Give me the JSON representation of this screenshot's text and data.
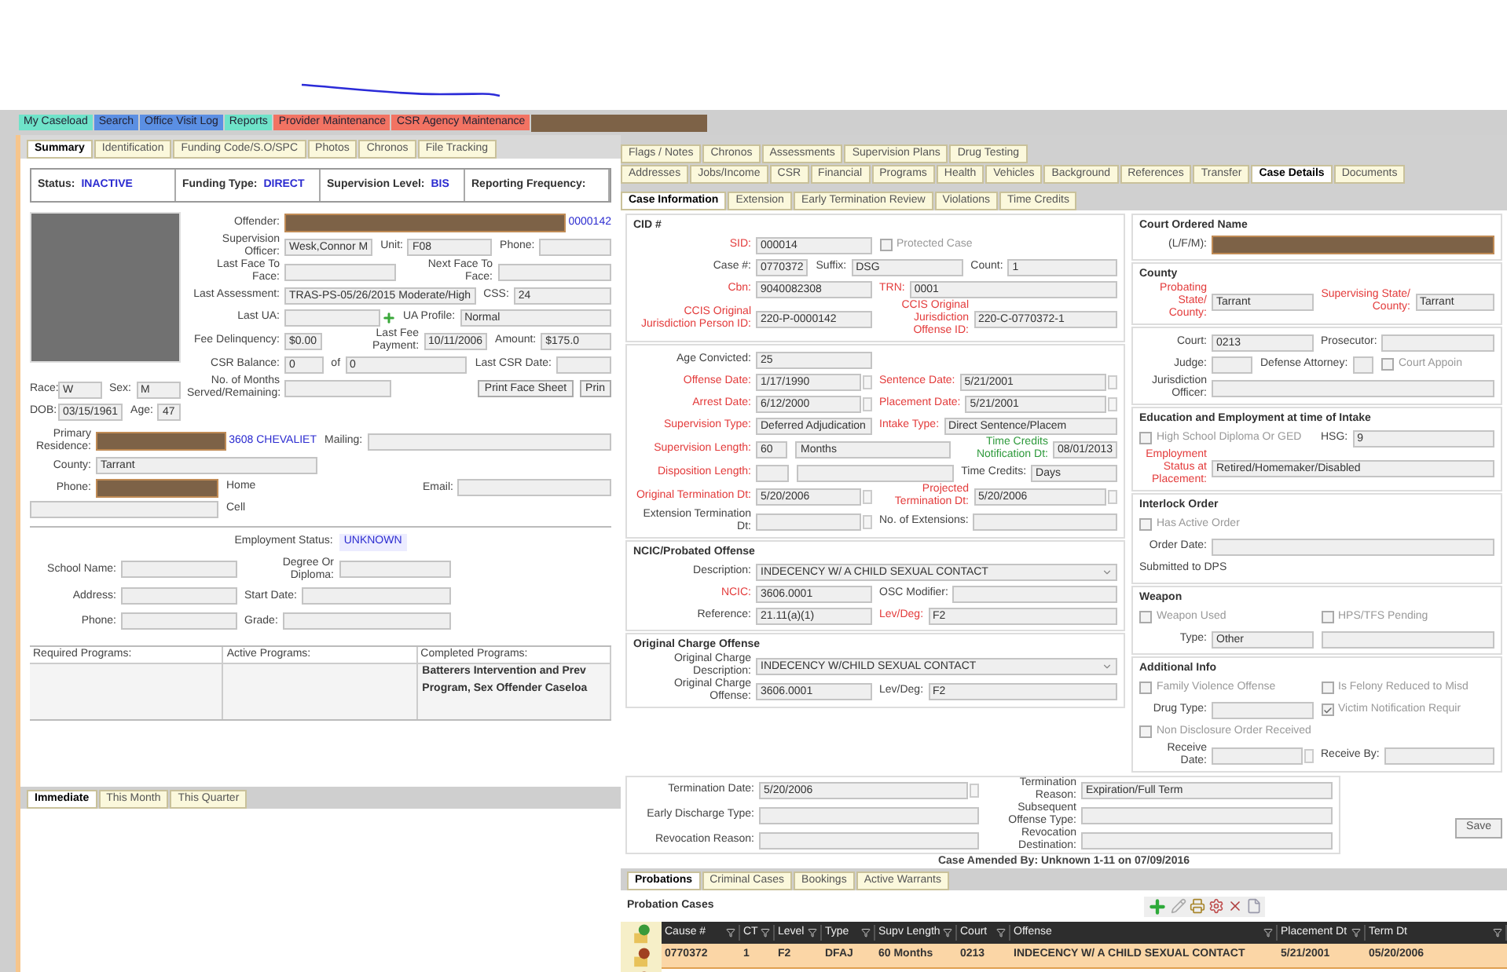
{
  "menu": [
    {
      "label": "My Caseload",
      "color": "#6fe3c9"
    },
    {
      "label": "Search",
      "color": "#5b8fe3"
    },
    {
      "label": "Office Visit Log",
      "color": "#5b8fe3"
    },
    {
      "label": "Reports",
      "color": "#6fe3c9"
    },
    {
      "label": "Provider Maintenance",
      "color": "#f27363"
    },
    {
      "label": "CSR Agency Maintenance",
      "color": "#f27363"
    }
  ],
  "menu_redacted": true,
  "left": {
    "tabs": [
      {
        "label": "Summary",
        "selected": true
      },
      {
        "label": "Identification",
        "selected": false
      },
      {
        "label": "Funding Code/S.O/SPC",
        "selected": false
      },
      {
        "label": "Photos",
        "selected": false
      },
      {
        "label": "Chronos",
        "selected": false
      },
      {
        "label": "File Tracking",
        "selected": false
      }
    ],
    "status": [
      {
        "label": "Status:",
        "value": "INACTIVE"
      },
      {
        "label": "Funding Type:",
        "value": "DIRECT"
      },
      {
        "label": "Supervision Level:",
        "value": "BIS"
      },
      {
        "label": "Reporting Frequency:"
      }
    ],
    "offender_rows": [
      [
        {
          "label": "Offender:",
          "value": "0000142",
          "redacted": true
        }
      ],
      [
        {
          "label": "Supervision Officer:",
          "value": "Wesk,Connor M"
        },
        {
          "label": "Unit:",
          "value": "F08"
        },
        {
          "label": "Phone:"
        }
      ],
      [
        {
          "label": "Last Face To Face:"
        },
        {
          "label": "Next Face To Face:"
        }
      ],
      [
        {
          "label": "Last Assessment:",
          "value": "TRAS-PS-05/26/2015 Moderate/High"
        },
        {
          "label": "CSS:",
          "value": "24"
        }
      ],
      [
        {
          "label": "Last UA:",
          "kind": "add"
        },
        {
          "label": "UA Profile:",
          "value": "Normal"
        }
      ],
      [
        {
          "label": "Fee Delinquency:",
          "value": "$0.00"
        },
        {
          "label": "Last Fee Payment:",
          "value": "10/11/2006"
        },
        {
          "label": "Amount:",
          "value": "$175.0"
        }
      ],
      [
        {
          "label": "CSR Balance:",
          "value": "0"
        },
        {
          "label": "of",
          "value": "0"
        },
        {
          "label": "Last CSR Date:"
        }
      ]
    ],
    "months_field": {
      "label": "No. of Months Served/Remaining:"
    },
    "face_sheet_buttons": [
      "Print Face Sheet",
      "Prin"
    ],
    "demographics": [
      [
        {
          "label": "Race:",
          "value": "W"
        },
        {
          "label": "Sex:",
          "value": "M"
        }
      ],
      [
        {
          "label": "DOB:",
          "value": "03/15/1961"
        },
        {
          "label": "Age:",
          "value": "47"
        }
      ]
    ],
    "contact_rows": [
      [
        {
          "label": "Primary Residence:",
          "value": "3608 CHEVALIET",
          "redacted": true
        },
        {
          "label": "Mailing:"
        }
      ],
      [
        {
          "label": "County:",
          "value": "Tarrant"
        },
        {
          "kind": "blank"
        }
      ],
      [
        {
          "label": "Phone:",
          "redacted": true
        },
        {
          "label": "Home",
          "kind": "note"
        },
        {
          "label": "Email:"
        }
      ],
      [
        {
          "kind": "box"
        },
        {
          "label": "Cell",
          "kind": "note"
        },
        {
          "kind": "blank"
        }
      ]
    ],
    "employment": {
      "label": "Employment Status:",
      "value": "UNKNOWN"
    },
    "school_rows": [
      [
        {
          "label": "School Name:"
        },
        {
          "label": "Degree Or Diploma:"
        }
      ],
      [
        {
          "label": "Address:"
        },
        {
          "label": "Start Date:"
        }
      ],
      [
        {
          "label": "Phone:"
        },
        {
          "label": "Grade:"
        }
      ]
    ],
    "programs": {
      "columns": [
        "Required Programs:",
        "Active Programs:",
        "Completed Programs:"
      ],
      "completed": [
        "Batterers Intervention and Prev",
        "Program, Sex Offender Caseloa"
      ]
    },
    "bottom_tabs": [
      {
        "label": "Immediate",
        "selected": true
      },
      {
        "label": "This Month",
        "selected": false
      },
      {
        "label": "This Quarter",
        "selected": false
      }
    ]
  },
  "right": {
    "tab_rows": [
      [
        {
          "label": "Flags / Notes",
          "selected": false
        },
        {
          "label": "Chronos",
          "selected": false
        },
        {
          "label": "Assessments",
          "selected": false
        },
        {
          "label": "Supervision Plans",
          "selected": false
        },
        {
          "label": "Drug Testing",
          "selected": false
        }
      ],
      [
        {
          "label": "Addresses",
          "selected": false
        },
        {
          "label": "Jobs/Income",
          "selected": false
        },
        {
          "label": "CSR",
          "selected": false
        },
        {
          "label": "Financial",
          "selected": false
        },
        {
          "label": "Programs",
          "selected": false
        },
        {
          "label": "Health",
          "selected": false
        },
        {
          "label": "Vehicles",
          "selected": false
        },
        {
          "label": "Background",
          "selected": false
        },
        {
          "label": "References",
          "selected": false
        },
        {
          "label": "Transfer",
          "selected": false
        },
        {
          "label": "Case Details",
          "selected": true
        },
        {
          "label": "Documents",
          "selected": false
        }
      ],
      [
        {
          "label": "Case Information",
          "selected": true
        },
        {
          "label": "Extension",
          "selected": false
        },
        {
          "label": "Early Termination Review",
          "selected": false
        },
        {
          "label": "Violations",
          "selected": false
        },
        {
          "label": "Time Credits",
          "selected": false
        }
      ]
    ],
    "case_sections": [
      {
        "title": "CID #",
        "rows": [
          [
            {
              "label": "SID:",
              "value": "000014",
              "color": "#e33b3b"
            },
            {
              "label": "Protected Case",
              "kind": "check",
              "checked": false
            }
          ],
          [
            {
              "label": "Case #:",
              "value": "0770372"
            },
            {
              "label": "Suffix:",
              "value": "DSG"
            },
            {
              "label": "Count:",
              "value": "1"
            }
          ],
          [
            {
              "label": "Cbn:",
              "value": "9040082308",
              "color": "#e33b3b"
            },
            {
              "label": "TRN:",
              "value": "0001",
              "color": "#e33b3b"
            }
          ],
          [
            {
              "label": "CCIS Original Jurisdiction Person ID:",
              "value": "220-P-0000142",
              "color": "#e33b3b"
            },
            {
              "label": "CCIS Original Jurisdiction Offense ID:",
              "value": "220-C-0770372-1",
              "color": "#e33b3b"
            }
          ]
        ]
      },
      {
        "rows": [
          [
            {
              "label": "Age Convicted:",
              "value": "25"
            },
            {
              "kind": "blank"
            }
          ],
          [
            {
              "label": "Offense Date:",
              "value": "1/17/1990",
              "color": "#e33b3b",
              "kind": "date"
            },
            {
              "label": "Sentence Date:",
              "value": "5/21/2001",
              "color": "#e33b3b",
              "kind": "date"
            }
          ],
          [
            {
              "label": "Arrest Date:",
              "value": "6/12/2000",
              "color": "#e33b3b",
              "kind": "date"
            },
            {
              "label": "Placement Date:",
              "value": "5/21/2001",
              "color": "#e33b3b",
              "kind": "date"
            }
          ],
          [
            {
              "label": "Supervision Type:",
              "value": "Deferred Adjudication",
              "color": "#e33b3b"
            },
            {
              "label": "Intake Type:",
              "value": "Direct Sentence/Placem",
              "color": "#e33b3b"
            }
          ],
          [
            {
              "label": "Supervision Length:",
              "value": "60",
              "color": "#e33b3b"
            },
            {
              "value": "Months",
              "kind": "bare"
            },
            {
              "label": "Time Credits Notification Dt:",
              "value": "08/01/2013",
              "color": "#2e9a3c"
            }
          ],
          [
            {
              "label": "Disposition Length:",
              "color": "#e33b3b"
            },
            {
              "kind": "bare"
            },
            {
              "label": "Time Credits:",
              "value": "Days"
            }
          ],
          [
            {
              "label": "Original Termination Dt:",
              "value": "5/20/2006",
              "color": "#e33b3b",
              "kind": "date"
            },
            {
              "label": "Projected Termination Dt:",
              "value": "5/20/2006",
              "color": "#e33b3b",
              "kind": "date"
            }
          ],
          [
            {
              "label": "Extension Termination Dt:",
              "kind": "date"
            },
            {
              "label": "No. of Extensions:"
            }
          ]
        ]
      },
      {
        "title": "NCIC/Probated Offense",
        "rows": [
          [
            {
              "label": "Description:",
              "value": "INDECENCY W/ A CHILD SEXUAL CONTACT",
              "kind": "select"
            }
          ],
          [
            {
              "label": "NCIC:",
              "value": "3606.0001",
              "color": "#e33b3b"
            },
            {
              "label": "OSC Modifier:"
            }
          ],
          [
            {
              "label": "Reference:",
              "value": "21.11(a)(1)"
            },
            {
              "label": "Lev/Deg:",
              "value": "F2",
              "color": "#e33b3b"
            }
          ]
        ]
      },
      {
        "title": "Original Charge Offense",
        "rows": [
          [
            {
              "label": "Original Charge Description:",
              "value": "INDECENCY W/CHILD SEXUAL CONTACT",
              "kind": "select"
            }
          ],
          [
            {
              "label": "Original Charge Offense:",
              "value": "3606.0001"
            },
            {
              "label": "Lev/Deg:",
              "value": "F2"
            }
          ]
        ]
      }
    ],
    "side_sections": [
      {
        "title": "Court Ordered Name",
        "rows": [
          [
            {
              "label": "(L/F/M):",
              "redacted": true
            }
          ]
        ]
      },
      {
        "title": "County",
        "rows": [
          [
            {
              "label": "Probating State/ County:",
              "value": "Tarrant",
              "color": "#e33b3b"
            },
            {
              "label": "Supervising State/ County:",
              "value": "Tarrant",
              "color": "#e33b3b"
            }
          ]
        ]
      },
      {
        "rows": [
          [
            {
              "label": "Court:",
              "value": "0213"
            },
            {
              "label": "Prosecutor:"
            }
          ],
          [
            {
              "label": "Judge:"
            },
            {
              "label": "Defense Attorney:"
            },
            {
              "label": "Court Appoin",
              "kind": "check",
              "checked": false
            }
          ],
          [
            {
              "label": "Jurisdiction Officer:"
            }
          ]
        ]
      },
      {
        "title": "Education and Employment at time of Intake",
        "rows": [
          [
            {
              "label": "High School Diploma Or GED",
              "kind": "check",
              "checked": false
            },
            {
              "label": "HSG:",
              "value": "9"
            }
          ],
          [
            {
              "label": "Employment Status at Placement:",
              "value": "Retired/Homemaker/Disabled",
              "color": "#e33b3b"
            }
          ]
        ]
      },
      {
        "title": "Interlock Order",
        "rows": [
          [
            {
              "label": "Has Active Order",
              "kind": "check",
              "checked": false
            }
          ],
          [
            {
              "label": "Order Date:"
            }
          ],
          [
            {
              "label": "Submitted to DPS",
              "kind": "note"
            }
          ]
        ]
      },
      {
        "title": "Weapon",
        "rows": [
          [
            {
              "label": "Weapon Used",
              "kind": "check",
              "checked": false
            },
            {
              "label": "HPS/TFS Pending",
              "kind": "check",
              "checked": false
            }
          ],
          [
            {
              "label": "Type:",
              "value": "Other"
            },
            {
              "kind": "box"
            }
          ]
        ]
      },
      {
        "title": "Additional Info",
        "rows": [
          [
            {
              "label": "Family Violence Offense",
              "kind": "check",
              "checked": false
            },
            {
              "label": "Is Felony Reduced to Misd",
              "kind": "check",
              "checked": false
            }
          ],
          [
            {
              "label": "Drug Type:"
            },
            {
              "label": "Victim Notification Requir",
              "kind": "check",
              "checked": true
            }
          ],
          [
            {
              "label": "Non Disclosure Order Received",
              "kind": "check",
              "checked": false
            }
          ],
          [
            {
              "label": "Receive Date:",
              "kind": "date"
            },
            {
              "label": "Receive By:"
            }
          ]
        ]
      }
    ],
    "termination_rows": [
      [
        {
          "label": "Termination Date:",
          "value": "5/20/2006",
          "kind": "date"
        },
        {
          "label": "Termination Reason:",
          "value": "Expiration/Full Term"
        }
      ],
      [
        {
          "label": "Early Discharge Type:"
        },
        {
          "label": "Subsequent Offense Type:"
        }
      ],
      [
        {
          "label": "Revocation Reason:"
        },
        {
          "label": "Revocation Destination:"
        }
      ]
    ],
    "save_button": "Save",
    "amended_note": "Case Amended By: Unknown 1-11 on 07/09/2016",
    "bottom_tabs": [
      {
        "label": "Probations",
        "selected": true
      },
      {
        "label": "Criminal Cases",
        "selected": false
      },
      {
        "label": "Bookings",
        "selected": false
      },
      {
        "label": "Active Warrants",
        "selected": false
      }
    ],
    "probation": {
      "title": "Probation Cases",
      "columns": [
        "Cause #",
        "CT",
        "Level",
        "Type",
        "Supv Length",
        "Court",
        "Offense",
        "Placement Dt",
        "Term Dt"
      ],
      "rows": [
        {
          "cells": [
            "0770372",
            "1",
            "F2",
            "DFAJ",
            "60 Months",
            "0213",
            "INDECENCY W/ A CHILD SEXUAL CONTACT",
            "5/21/2001",
            "05/20/2006"
          ],
          "selected": true
        }
      ]
    }
  }
}
